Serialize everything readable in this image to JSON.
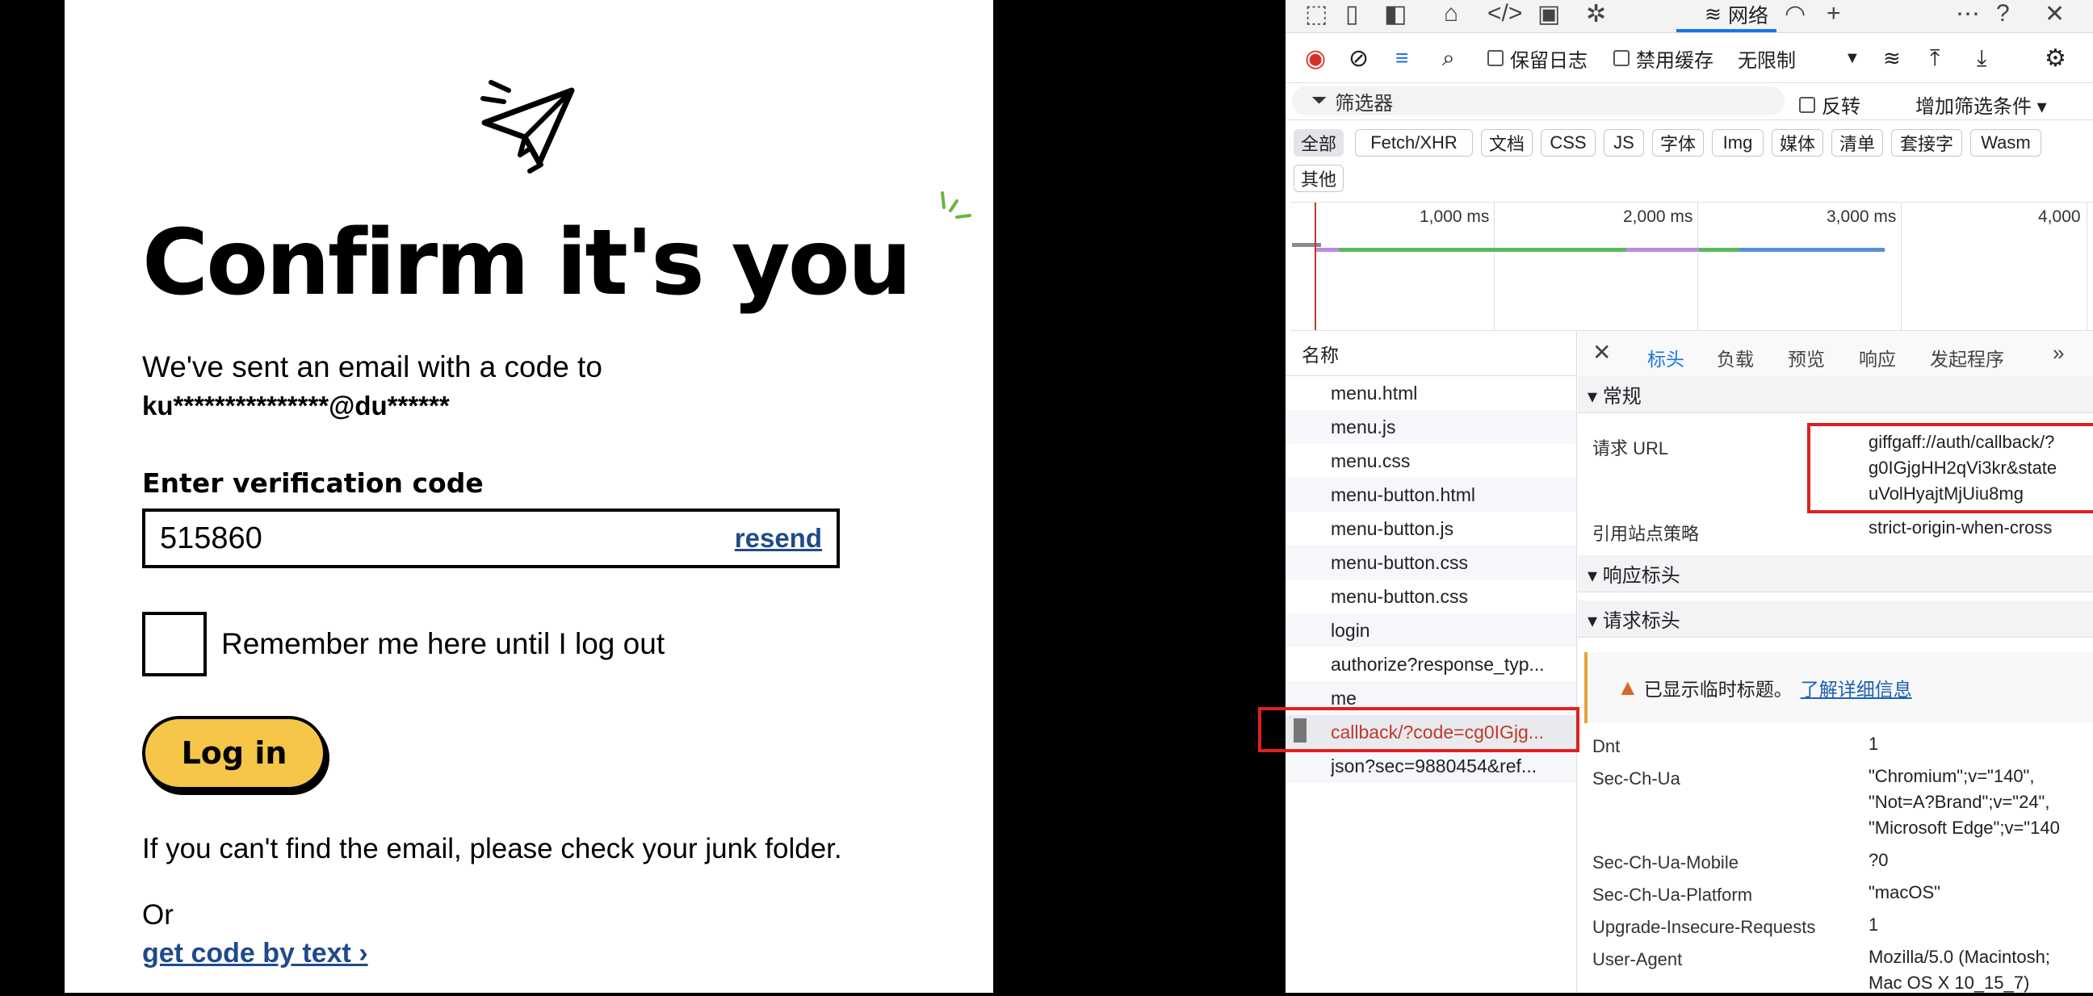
{
  "login": {
    "title": "Confirm it's you",
    "sent_text": "We've sent an email with a code to",
    "email_masked": "ku***************@du******",
    "code_label": "Enter verification code",
    "code_value": "515860",
    "resend": "resend",
    "remember_label": "Remember me here until I log out",
    "login_button": "Log in",
    "junk_text": "If you can't find the email, please check your junk folder.",
    "or_text": "Or",
    "get_code_link": "get code by text ›",
    "button_color": "#f5c647",
    "link_color": "#1f4a8c"
  },
  "devtools": {
    "active_tab": "网络",
    "toolbar": {
      "preserve_log": "保留日志",
      "disable_cache": "禁用缓存",
      "throttle": "无限制"
    },
    "filter": {
      "placeholder": "筛选器",
      "invert": "反转",
      "more_filters": "增加筛选条件"
    },
    "type_chips": [
      "全部",
      "Fetch/XHR",
      "文档",
      "CSS",
      "JS",
      "字体",
      "Img",
      "媒体",
      "清单",
      "套接字",
      "Wasm",
      "其他"
    ],
    "timeline_labels": [
      "1,000 ms",
      "2,000 ms",
      "3,000 ms",
      "4,000"
    ],
    "name_header": "名称",
    "requests": [
      "menu.html",
      "menu.js",
      "menu.css",
      "menu-button.html",
      "menu-button.js",
      "menu-button.css",
      "menu-button.css",
      "login",
      "authorize?response_typ...",
      "me",
      "callback/?code=cg0IGjg...",
      "json?sec=9880454&ref..."
    ],
    "detail_tabs": [
      "标头",
      "负载",
      "预览",
      "响应",
      "发起程序"
    ],
    "general_section": "▾ 常规",
    "request_url_key": "请求 URL",
    "request_url_lines": [
      "giffgaff://auth/callback/?",
      "g0IGjgHH2qVi3kr&state",
      "uVolHyajtMjUiu8mg"
    ],
    "referrer_key": "引用站点策略",
    "referrer_value": "strict-origin-when-cross",
    "response_headers": "▾ 响应标头",
    "request_headers": "▾ 请求标头",
    "warning_text": "已显示临时标题。",
    "warning_link": "了解详细信息",
    "headers": [
      {
        "key": "Dnt",
        "value": "1"
      },
      {
        "key": "Sec-Ch-Ua",
        "value": "\"Chromium\";v=\"140\",",
        "value2": "\"Not=A?Brand\";v=\"24\",",
        "value3": "\"Microsoft Edge\";v=\"140"
      },
      {
        "key": "Sec-Ch-Ua-Mobile",
        "value": "?0"
      },
      {
        "key": "Sec-Ch-Ua-Platform",
        "value": "\"macOS\""
      },
      {
        "key": "Upgrade-Insecure-Requests",
        "value": "1"
      },
      {
        "key": "User-Agent",
        "value": "Mozilla/5.0 (Macintosh;",
        "value2": "Mac OS X 10_15_7)"
      }
    ]
  }
}
